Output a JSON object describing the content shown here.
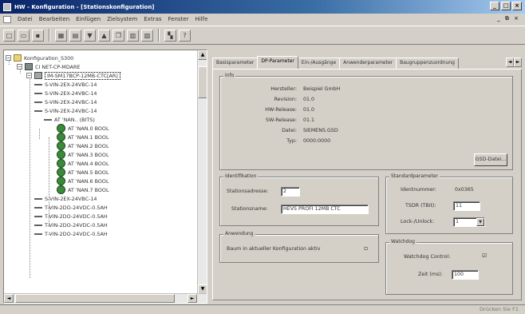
{
  "window": {
    "title": "HW - Konfiguration - [Stationskonfiguration]",
    "controls": [
      "_",
      "□",
      "×"
    ]
  },
  "menu": {
    "items": [
      "Datei",
      "Bearbeiten",
      "Einfügen",
      "Zielsystem",
      "Extras",
      "Fenster",
      "Hilfe"
    ],
    "mdi_controls": "_ ⧉ ×"
  },
  "toolbar": {
    "buttons": [
      "new-icon",
      "open-icon",
      "save-icon",
      "compile-icon",
      "print-icon",
      "download-icon",
      "upload-icon",
      "copy-icon",
      "paste-icon",
      "catalog-icon",
      "help-icon",
      "network-icon",
      "whatis-icon"
    ]
  },
  "tree": {
    "nodes": [
      {
        "label": "Konfiguration_S300",
        "expander": "−",
        "icon": "folder"
      },
      {
        "label": "CI NET-CP-MDARE",
        "expander": "−",
        "icon": "cpu"
      },
      {
        "label": "IM-SM17BCP-12MB-CTC[AR]",
        "expander": "−",
        "icon": "mod"
      },
      {
        "label": "S-VIN-2EX-24VBC-14",
        "expander": "",
        "icon": "dash"
      },
      {
        "label": "S-VIN-2EX-24VBC-14",
        "expander": "",
        "icon": "dash"
      },
      {
        "label": "S-VIN-2EX-24VBC-14",
        "expander": "",
        "icon": "dash"
      },
      {
        "label": "S-VIN-2EX-24VBC-14",
        "expander": "",
        "icon": "dash"
      },
      {
        "label": "AT 'NAN.. (BITS)",
        "expander": "",
        "icon": "dash"
      },
      {
        "label": "AT 'NAN.0 BOOL",
        "expander": "",
        "icon": "dot"
      },
      {
        "label": "AT 'NAN.1 BOOL",
        "expander": "",
        "icon": "dot"
      },
      {
        "label": "AT 'NAN.2 BOOL",
        "expander": "",
        "icon": "dot"
      },
      {
        "label": "AT 'NAN.3 BOOL",
        "expander": "",
        "icon": "dot"
      },
      {
        "label": "AT 'NAN.4 BOOL",
        "expander": "",
        "icon": "dot"
      },
      {
        "label": "AT 'NAN.5 BOOL",
        "expander": "",
        "icon": "dot"
      },
      {
        "label": "AT 'NAN.6 BOOL",
        "expander": "",
        "icon": "dot"
      },
      {
        "label": "AT 'NAN.7 BOOL",
        "expander": "",
        "icon": "dot"
      },
      {
        "label": "S-VIN-2EX-24VBC-14",
        "expander": "",
        "icon": "dash"
      },
      {
        "label": "T-VIN-2DO-24VDC-0.5AH",
        "expander": "",
        "icon": "dash"
      },
      {
        "label": "T-VIN-2DO-24VDC-0.5AH",
        "expander": "",
        "icon": "dash"
      },
      {
        "label": "T-VIN-2DO-24VDC-0.5AH",
        "expander": "",
        "icon": "dash"
      },
      {
        "label": "T-VIN-2DO-24VDC-0.5AH",
        "expander": "",
        "icon": "dash"
      }
    ],
    "selected_index": 2
  },
  "tabs": [
    {
      "label": "Basisparameter",
      "active": false
    },
    {
      "label": "DP-Parameter",
      "active": true
    },
    {
      "label": "Ein-/Ausgänge",
      "active": false
    },
    {
      "label": "Anwenderparameter",
      "active": false
    },
    {
      "label": "Baugruppenzuordnung",
      "active": false
    }
  ],
  "tab_arrows": [
    "◄",
    "►"
  ],
  "info_group": {
    "label": "Info",
    "rows": [
      {
        "key": "Hersteller:",
        "value": "Beispiel GmbH"
      },
      {
        "key": "Revision:",
        "value": "01.0"
      },
      {
        "key": "HW-Release:",
        "value": "01.0"
      },
      {
        "key": "SW-Release:",
        "value": "01.1"
      },
      {
        "key": "Datei:",
        "value": "SIEMENS.GSD"
      },
      {
        "key": "Typ:",
        "value": "0000:0000"
      }
    ],
    "gsd_button": "GSD-Datei..."
  },
  "ident_group": {
    "label": "Identifikation",
    "station_addr_label": "Stationsadresse:",
    "station_addr_value": "2",
    "station_name_label": "Stationsname:",
    "station_name_value": "HEVS PROFI 12MB CTC"
  },
  "settings_group": {
    "label": "Anwendung",
    "text": "Baum in aktueller Konfiguration aktiv"
  },
  "standard_group": {
    "label": "Standardparameter",
    "ident_label": "Identnummer:",
    "ident_value": "0x0365",
    "tsdr_label": "TSDR (TBit):",
    "tsdr_value": "11",
    "lock_label": "Lock-/Unlock:",
    "lock_value": "1"
  },
  "watchdog_group": {
    "label": "Watchdog",
    "control_label": "Watchdog Control:",
    "time_label": "Zeit (ms):",
    "time_value": "100"
  },
  "status": {
    "text": "Drücken Sie F1"
  }
}
